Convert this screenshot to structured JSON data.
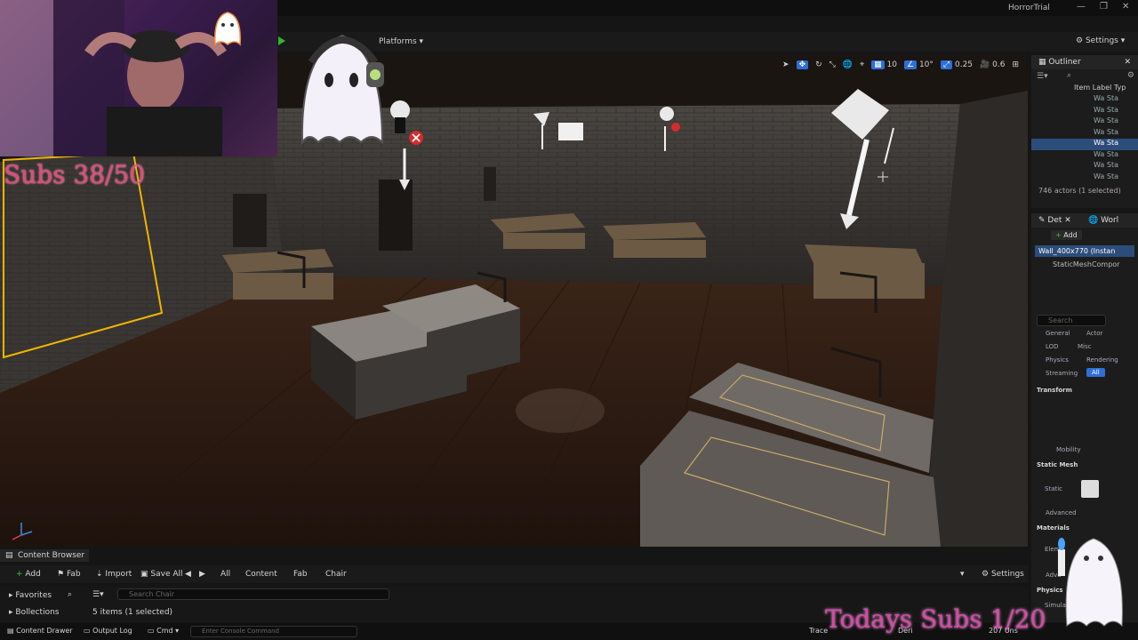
{
  "window": {
    "title": "HorrorTrial"
  },
  "toolbar": {
    "platforms_label": "Platforms",
    "settings_label": "Settings"
  },
  "viewport": {
    "grid_snap": "10",
    "rotation_snap": "10°",
    "scale_snap": "0.25",
    "camera_speed": "0.6"
  },
  "outliner": {
    "tab_label": "Outliner",
    "column_header": "Item Label Typ",
    "rows": [
      {
        "label": "Wa",
        "type": "Sta"
      },
      {
        "label": "Wa",
        "type": "Sta"
      },
      {
        "label": "Wa",
        "type": "Sta"
      },
      {
        "label": "Wa",
        "type": "Sta"
      },
      {
        "label": "Wa",
        "type": "Sta"
      },
      {
        "label": "Wa",
        "type": "Sta"
      },
      {
        "label": "Wa",
        "type": "Sta"
      },
      {
        "label": "Wa",
        "type": "Sta"
      }
    ],
    "actor_count": "746 actors (1 selected)"
  },
  "details": {
    "tab_label": "Det",
    "world_tab_label": "Worl",
    "add_label": "Add",
    "selected_actor": "Wall_400x770 (Instan",
    "component": "StaticMeshCompor",
    "search_placeholder": "Search",
    "categories": [
      "General",
      "Actor",
      "LOD",
      "Misc",
      "Physics",
      "Rendering",
      "Streaming",
      "All"
    ],
    "sections": {
      "transform": "Transform",
      "static_mesh": "Static Mesh",
      "advanced": "Advanced",
      "materials": "Materials",
      "physics": "Physics"
    },
    "mobility_label": "Mobility",
    "static_label": "Static",
    "element_label": "Eleme",
    "simulate_label": "Simulat",
    "advanced2_label": "Adva"
  },
  "content_browser": {
    "tab_label": "Content Browser",
    "add_label": "Add",
    "fab_label": "Fab",
    "import_label": "Import",
    "save_all_label": "Save All",
    "breadcrumb": [
      "All",
      "Content",
      "Fab",
      "Chair"
    ],
    "settings_label": "Settings",
    "favorites_label": "Favorites",
    "collections_label": "Bollections",
    "search_placeholder": "Search Chair",
    "items_count": "5 items (1 selected)"
  },
  "statusbar": {
    "content_drawer": "Content Drawer",
    "output_log": "Output Log",
    "cmd": "Cmd",
    "console_placeholder": "Enter Console Command",
    "trace": "Trace",
    "derived": "Deri",
    "unsaved": "207 Uns"
  },
  "overlay": {
    "subs_goal": "Subs 38/50",
    "todays_subs": "Todays Subs 1/20"
  },
  "colors": {
    "accent_blue": "#2e6fd6",
    "selection_yellow": "#f0b400",
    "subs_pink": "#e24a7a",
    "todays_pink": "#d64aa7"
  }
}
